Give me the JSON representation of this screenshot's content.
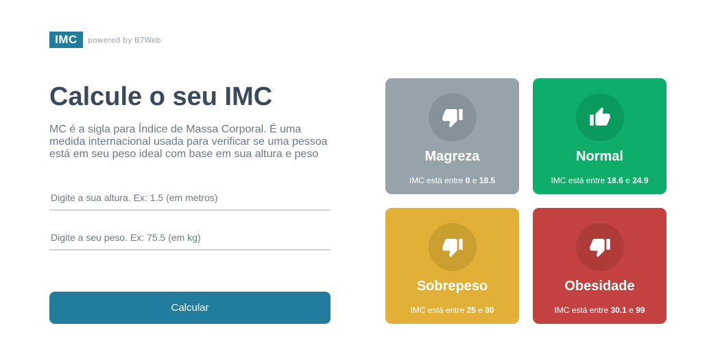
{
  "header": {
    "logo": "IMC",
    "powered_by": "powered by B7Web"
  },
  "main": {
    "title": "Calcule o seu IMC",
    "description": "MC é a sigla para Índice de Massa Corporal. É uma medida internacional usada para verificar se uma pessoa está em seu peso ideal com base em sua altura e peso",
    "height_placeholder": "Digite a sua altura. Ex: 1.5 (em metros)",
    "weight_placeholder": "Digite a seu peso. Ex: 75.5 (em kg)",
    "calculate_label": "Calcular"
  },
  "cards": [
    {
      "title": "Magreza",
      "range_prefix": "IMC está entre ",
      "min": "0",
      "joiner": " e ",
      "max": "18.5",
      "color": "#96a3ab",
      "icon": "thumbs-down-icon"
    },
    {
      "title": "Normal",
      "range_prefix": "IMC está entre ",
      "min": "18.6",
      "joiner": " e ",
      "max": "24.9",
      "color": "#0ead69",
      "icon": "thumbs-up-icon"
    },
    {
      "title": "Sobrepeso",
      "range_prefix": "IMC está entre ",
      "min": "25",
      "joiner": " e ",
      "max": "30",
      "color": "#e2b036",
      "icon": "thumbs-down-icon"
    },
    {
      "title": "Obesidade",
      "range_prefix": "IMC está entre ",
      "min": "30.1",
      "joiner": " e ",
      "max": "99",
      "color": "#c3423f",
      "icon": "thumbs-down-icon"
    }
  ]
}
